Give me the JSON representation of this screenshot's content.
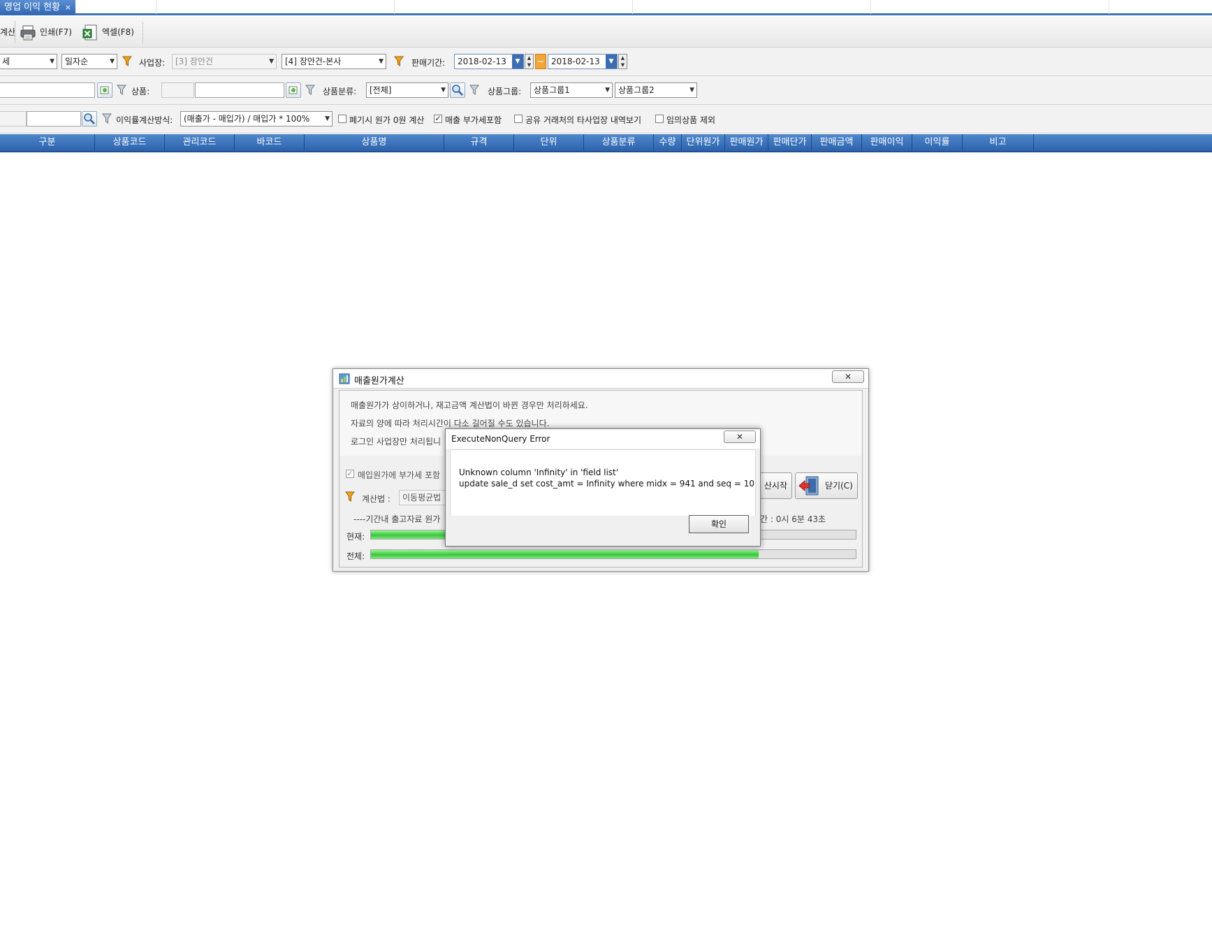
{
  "tabs": [
    {
      "label": "영업 이익 현황",
      "close": "×",
      "active": true
    }
  ],
  "toolbar": {
    "calc_label": "계산",
    "print_label": "인쇄(F7)",
    "excel_label": "엑셀(F8)"
  },
  "filters": {
    "row1": {
      "detail_combo": "세",
      "sort_combo": "일자순",
      "workplace_label": "사업장:",
      "workplace_value": "[3] 장안건",
      "workplace2_value": "[4] 장안건-본사",
      "period_label": "판매기간:",
      "date_from": "2018-02-13",
      "date_to": "2018-02-13",
      "tilde": "~"
    },
    "row2": {
      "product_label": "상품:",
      "category_label": "상품분류:",
      "category_value": "[전체]",
      "group_label": "상품그룹:",
      "group1_value": "상품그룹1",
      "group2_value": "상품그룹2"
    },
    "row3": {
      "method_label": "이익률계산방식:",
      "method_value": "(매출가 - 매입가) / 매입가 * 100%",
      "cb_discard_label": "폐기시 원가 0원 계산",
      "cb_discard_checked": false,
      "cb_vat_label": "매출 부가세포함",
      "cb_vat_checked": true,
      "cb_shared_label": "공유 거래처의 타사업장 내역보기",
      "cb_shared_checked": false,
      "cb_temp_label": "임의상품 제외",
      "cb_temp_checked": false
    }
  },
  "grid": {
    "columns": [
      "구분",
      "상품코드",
      "관리코드",
      "바코드",
      "상품명",
      "규격",
      "단위",
      "상품분류",
      "수량",
      "단위원가",
      "판매원가",
      "판매단가",
      "판매금액",
      "판매이익",
      "이익률",
      "비고"
    ]
  },
  "cost_dialog": {
    "title": "매출원가계산",
    "messages": [
      "매출원가가 상이하거나, 재고금액 계산법이 바뀐 경우만 처리하세요.",
      "자료의 양에 따라 처리시간이 다소 길어질 수도 있습니다.",
      "로그인 사업장만 처리됩니"
    ],
    "vat_checkbox_label": "매입원가에 부가세 포함",
    "method_label": "계산법 :",
    "method_value": "이동평균법",
    "status_text": "----기간내 출고자료 원가",
    "elapsed_text": "간 : 0시 6분 43초",
    "start_button": "산시작",
    "close_button": "닫기(C)",
    "current_label": "현재:",
    "total_label": "전체:",
    "current_progress": 0.18,
    "total_progress": 0.8
  },
  "error_dialog": {
    "title": "ExecuteNonQuery Error",
    "line1": "Unknown column 'Infinity' in 'field list'",
    "line2": " update sale_d set cost_amt = Infinity where  midx = 941 and seq = 10",
    "ok_button": "확인"
  },
  "colors": {
    "accent_blue": "#2d63ad",
    "progress_green": "#37c83a",
    "date_tilde_orange": "#f2a53b"
  }
}
